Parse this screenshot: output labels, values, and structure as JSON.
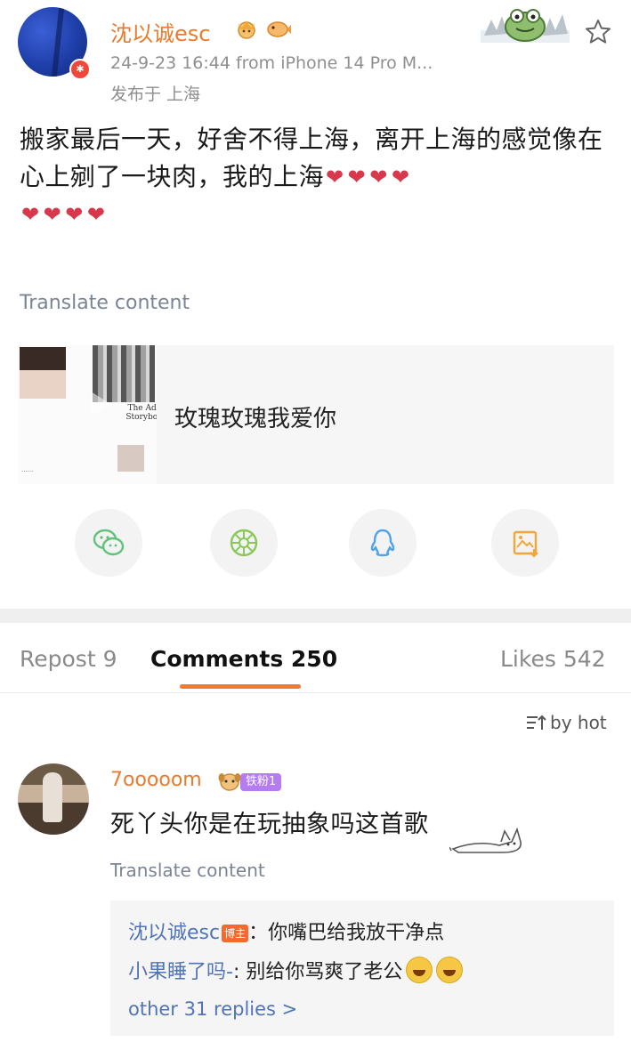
{
  "post": {
    "username": "沈以诚esc",
    "timestamp": "24-9-23 16:44",
    "source": "from iPhone 14 Pro M...",
    "location": "发布于 上海",
    "text": "搬家最后一天，好舍不得上海，离开上海的感觉像在心上剜了一块肉，我的上海",
    "broken_heart_count_line1": 4,
    "broken_heart_count_line2": 4,
    "translate_label": "Translate content"
  },
  "music_card": {
    "song_title": "玫瑰玫瑰我爱你",
    "album_text": "The Adult Storybook"
  },
  "share": {
    "icons": [
      "wechat-icon",
      "moments-icon",
      "qq-icon",
      "save-image-icon"
    ]
  },
  "tabs": {
    "repost": "Repost 9",
    "comments": "Comments 250",
    "likes": "Likes 542"
  },
  "sort": {
    "label": "by hot"
  },
  "comment": {
    "username": "7ooooom",
    "fan_badge": "铁粉1",
    "text": "死丫头你是在玩抽象吗这首歌",
    "translate_label": "Translate content",
    "replies": [
      {
        "name": "沈以诚esc",
        "tag": "博主",
        "text": "：你嘴巴给我放干净点"
      },
      {
        "name": "小果睡了吗-",
        "text": ": 别给你骂爽了老公"
      }
    ],
    "more_replies": "other 31 replies >"
  },
  "colors": {
    "accent_orange": "#f07a31",
    "username_orange": "#ec7a2b",
    "link_blue": "#4f74b8",
    "broken_heart": "#d7384b"
  }
}
